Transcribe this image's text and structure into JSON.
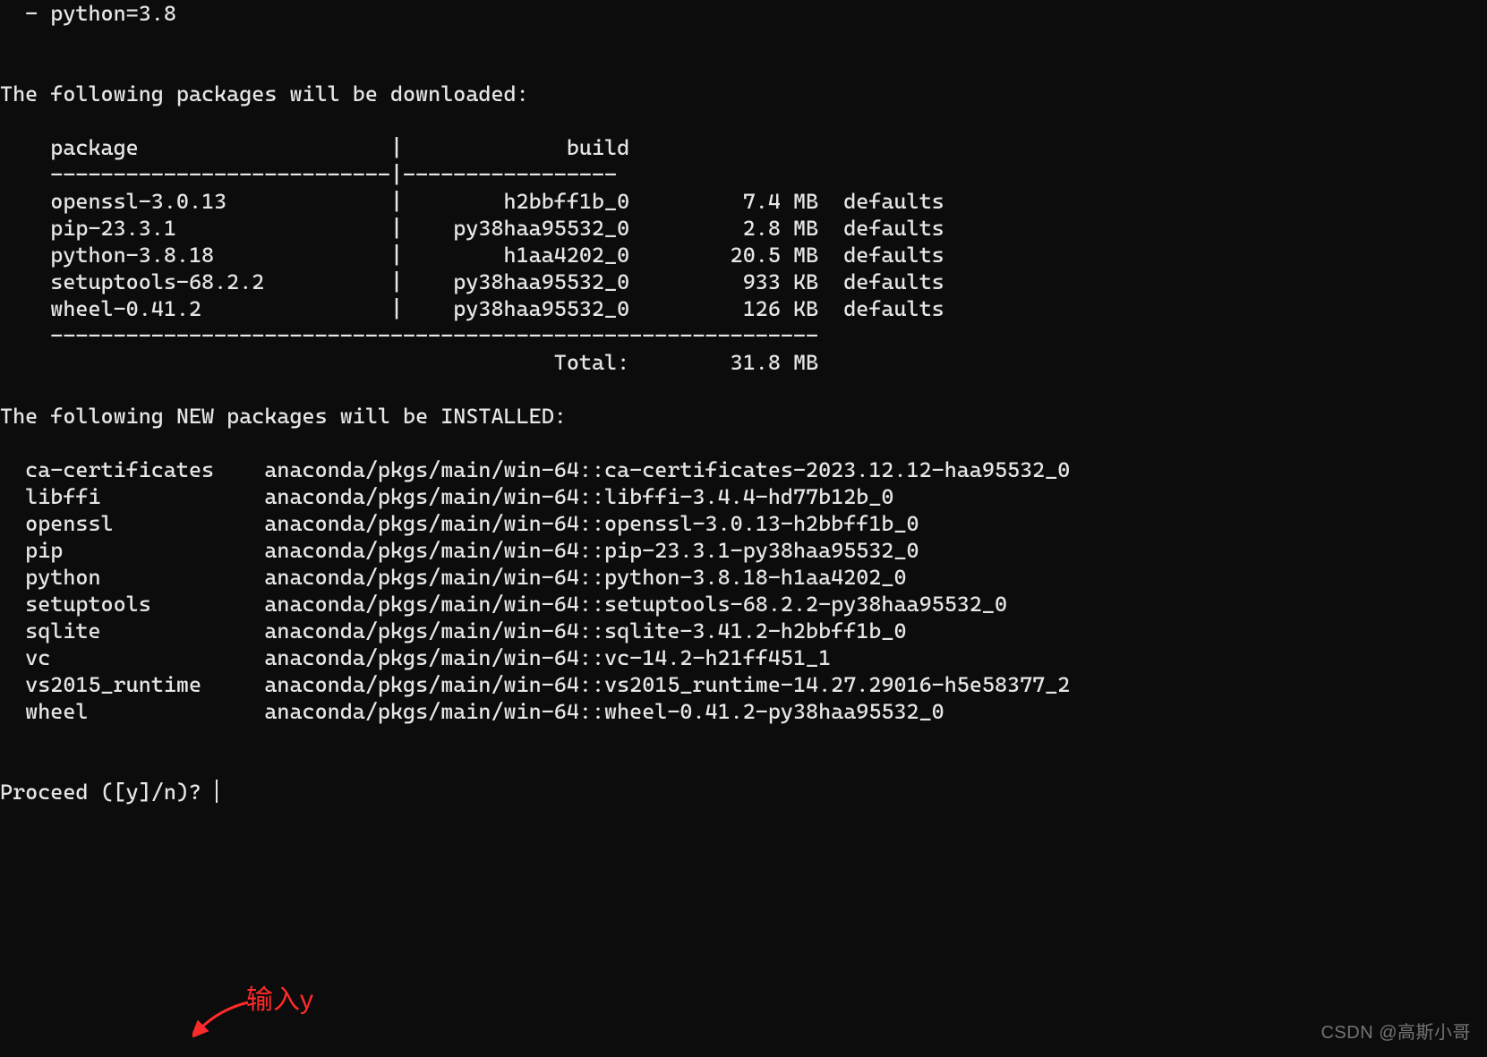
{
  "env_spec": {
    "bullet": "  - python=3.8"
  },
  "download_section": {
    "heading": "The following packages will be downloaded:",
    "header_cols": {
      "package": "package",
      "build": "build"
    },
    "rows": [
      {
        "package": "openssl-3.0.13",
        "build": "h2bbff1b_0",
        "size": "7.4 MB",
        "channel": "defaults"
      },
      {
        "package": "pip-23.3.1",
        "build": "py38haa95532_0",
        "size": "2.8 MB",
        "channel": "defaults"
      },
      {
        "package": "python-3.8.18",
        "build": "h1aa4202_0",
        "size": "20.5 MB",
        "channel": "defaults"
      },
      {
        "package": "setuptools-68.2.2",
        "build": "py38haa95532_0",
        "size": "933 KB",
        "channel": "defaults"
      },
      {
        "package": "wheel-0.41.2",
        "build": "py38haa95532_0",
        "size": "126 KB",
        "channel": "defaults"
      }
    ],
    "total_label": "Total:",
    "total_value": "31.8 MB"
  },
  "install_section": {
    "heading": "The following NEW packages will be INSTALLED:",
    "rows": [
      {
        "name": "ca-certificates",
        "spec": "anaconda/pkgs/main/win-64::ca-certificates-2023.12.12-haa95532_0"
      },
      {
        "name": "libffi",
        "spec": "anaconda/pkgs/main/win-64::libffi-3.4.4-hd77b12b_0"
      },
      {
        "name": "openssl",
        "spec": "anaconda/pkgs/main/win-64::openssl-3.0.13-h2bbff1b_0"
      },
      {
        "name": "pip",
        "spec": "anaconda/pkgs/main/win-64::pip-23.3.1-py38haa95532_0"
      },
      {
        "name": "python",
        "spec": "anaconda/pkgs/main/win-64::python-3.8.18-h1aa4202_0"
      },
      {
        "name": "setuptools",
        "spec": "anaconda/pkgs/main/win-64::setuptools-68.2.2-py38haa95532_0"
      },
      {
        "name": "sqlite",
        "spec": "anaconda/pkgs/main/win-64::sqlite-3.41.2-h2bbff1b_0"
      },
      {
        "name": "vc",
        "spec": "anaconda/pkgs/main/win-64::vc-14.2-h21ff451_1"
      },
      {
        "name": "vs2015_runtime",
        "spec": "anaconda/pkgs/main/win-64::vs2015_runtime-14.27.29016-h5e58377_2"
      },
      {
        "name": "wheel",
        "spec": "anaconda/pkgs/main/win-64::wheel-0.41.2-py38haa95532_0"
      }
    ]
  },
  "prompt": {
    "text": "Proceed ([y]/n)? ",
    "input_value": ""
  },
  "annotation": {
    "text": "输入y",
    "color": "#ff2a2a"
  },
  "watermark": {
    "text": "CSDN @高斯小哥"
  }
}
